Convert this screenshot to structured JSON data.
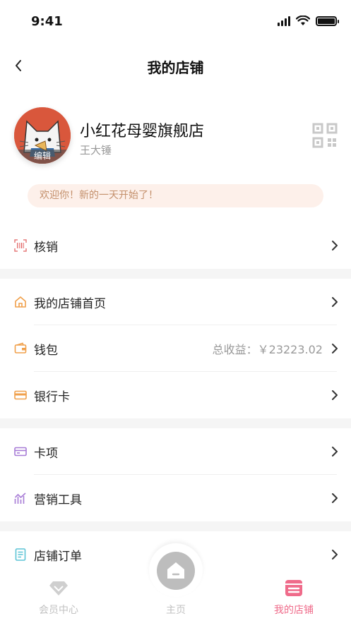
{
  "status_bar": {
    "time": "9:41"
  },
  "nav": {
    "title": "我的店铺"
  },
  "profile": {
    "shop_name": "小红花母婴旗舰店",
    "owner_name": "王大锤",
    "avatar_edit_label": "编辑"
  },
  "welcome": {
    "text": "欢迎你！新的一天开始了！"
  },
  "menu": {
    "verify": {
      "label": "核销",
      "icon": "scan-barcode-icon"
    },
    "store_home": {
      "label": "我的店铺首页",
      "icon": "house-icon"
    },
    "wallet": {
      "label": "钱包",
      "value": "总收益：￥23223.02",
      "icon": "wallet-icon"
    },
    "bank_card": {
      "label": "银行卡",
      "icon": "bank-card-icon"
    },
    "card_items": {
      "label": "卡项",
      "icon": "card-icon"
    },
    "marketing": {
      "label": "营销工具",
      "icon": "chart-icon"
    },
    "orders": {
      "label": "店铺订单",
      "icon": "document-icon"
    }
  },
  "tab_bar": {
    "member": {
      "label": "会员中心",
      "icon": "diamond-icon"
    },
    "home": {
      "label": "主页",
      "icon": "home-icon"
    },
    "store": {
      "label": "我的店铺",
      "icon": "store-icon"
    }
  },
  "colors": {
    "accent_pink": "#ef6b8a",
    "verify_icon": "#e67a7a",
    "orange_icon": "#f0a04b",
    "purple_icon": "#a77bd6",
    "teal_icon": "#5cc4d6",
    "welcome_bg": "#fdf0ea",
    "welcome_text": "#c4906c"
  }
}
